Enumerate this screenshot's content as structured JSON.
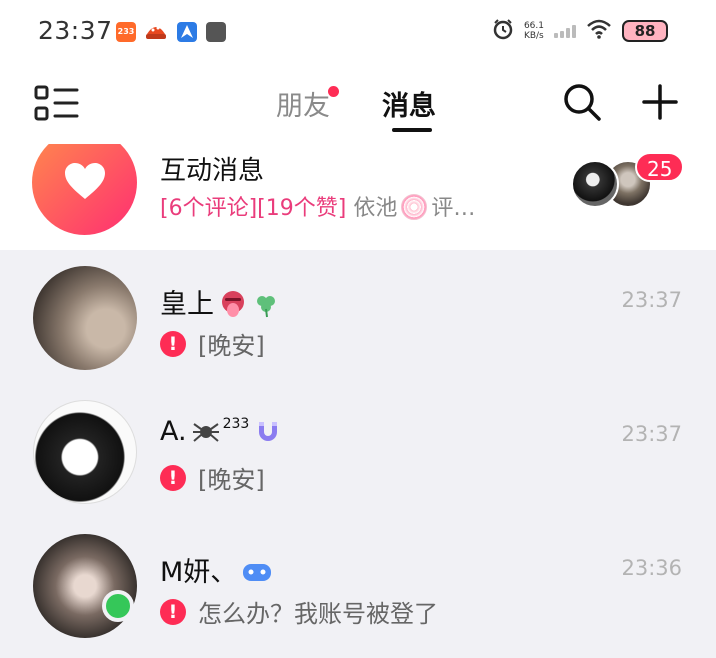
{
  "status_bar": {
    "time": "23:37",
    "app1_label": "233",
    "net_speed_value": "66.1",
    "net_speed_unit": "KB/s",
    "battery": "88"
  },
  "header": {
    "tab_friends": "朋友",
    "tab_messages": "消息"
  },
  "interaction": {
    "title": "互动消息",
    "comments": "[6个评论]",
    "likes": "[19个赞]",
    "sender": "依池",
    "trailing": "评…",
    "badge_count": "25"
  },
  "chats": [
    {
      "name": "皇上",
      "time": "23:37",
      "message": "[晚安]"
    },
    {
      "name": "A.",
      "name_sup": "233",
      "time": "23:37",
      "message": "[晚安]"
    },
    {
      "name": "M妍、",
      "time": "23:36",
      "message": "怎么办？我账号被登了"
    }
  ],
  "colors": {
    "accent": "#fe2c55",
    "interaction_pink": "#ea3c7b",
    "online": "#35c759"
  }
}
